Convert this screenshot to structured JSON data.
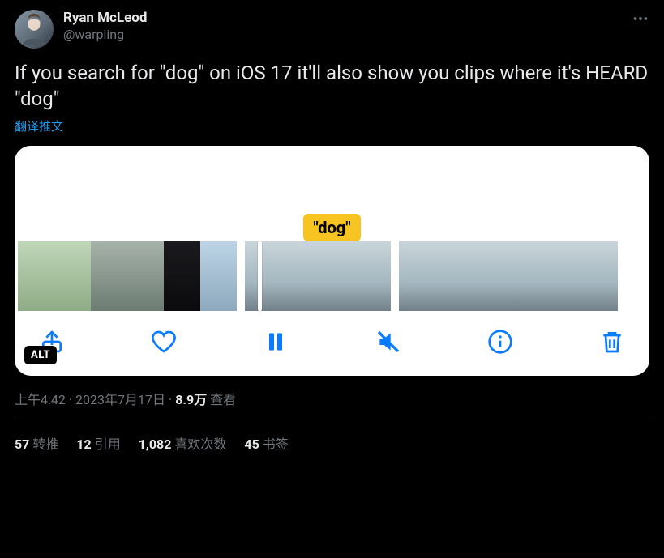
{
  "author": {
    "display_name": "Ryan McLeod",
    "handle": "@warpling"
  },
  "tweet_text": "If you search for \"dog\" on iOS 17 it'll also show you clips where it's HEARD \"dog\"",
  "translate_label": "翻译推文",
  "media": {
    "caption_bubble": "\"dog\"",
    "alt_badge": "ALT"
  },
  "meta": {
    "time": "上午4:42",
    "date": "2023年7月17日",
    "views_number": "8.9万",
    "views_label": " 查看"
  },
  "stats": {
    "retweets_num": "57",
    "retweets_label": "转推",
    "quotes_num": "12",
    "quotes_label": "引用",
    "likes_num": "1,082",
    "likes_label": "喜欢次数",
    "bookmarks_num": "45",
    "bookmarks_label": "书签"
  }
}
